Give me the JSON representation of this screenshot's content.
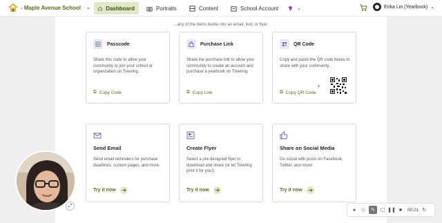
{
  "nav": {
    "school": "- Maple Avenue School",
    "items": [
      {
        "label": "Dashboard",
        "active": true
      },
      {
        "label": "Portraits"
      },
      {
        "label": "Content"
      },
      {
        "label": "School Account"
      }
    ],
    "user": "Erika Lin (Yearbook)"
  },
  "subtitle": "...any of the items below into an email, text, or flyer.",
  "share_cards": [
    {
      "title": "Passcode",
      "description": "Share this code to allow your community to join your school or organization on Treering.",
      "action": "Copy Code"
    },
    {
      "title": "Purchase Link",
      "description": "Share the purchase link to allow your community to create an account and purchase a yearbook on Treering.",
      "action": "Copy Link"
    },
    {
      "title": "QR Code",
      "description": "Copy and paste the QR code below to share with your community.",
      "action": "Copy QR Code"
    }
  ],
  "try_cards": [
    {
      "title": "Send Email",
      "description": "Send email reminders for purchase deadlines, custom pages, and more.",
      "action": "Try it now"
    },
    {
      "title": "Create Flyer",
      "description": "Select a pre-designed flyer to download and share (or let Treering print it for you!).",
      "action": "Try it now"
    },
    {
      "title": "Share on Social Media",
      "description": "Go social with posts on Facebook, Twitter, and more!",
      "action": "Try it now"
    }
  ],
  "recorder": {
    "time": "00:21"
  },
  "colors": {
    "accent": "#5c6a1e",
    "accent_bg": "#dfe8c9"
  }
}
